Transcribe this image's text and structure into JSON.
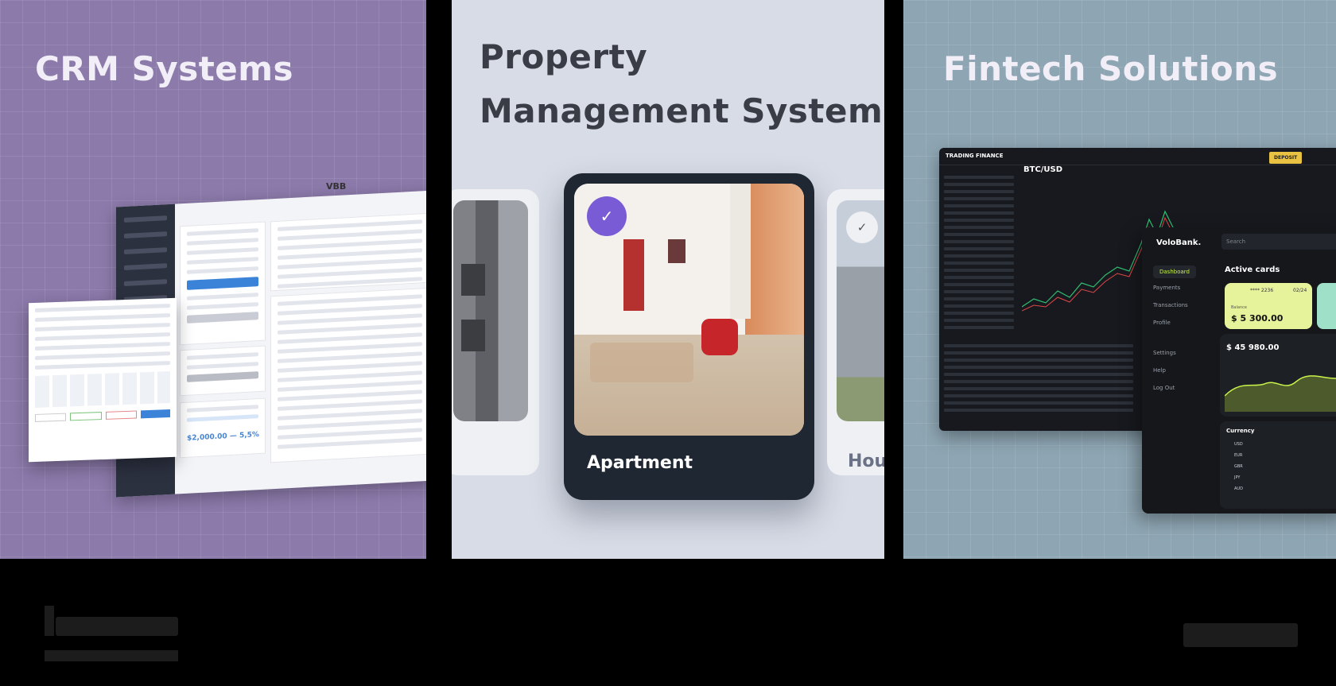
{
  "panels": [
    {
      "title": "CRM Systems"
    },
    {
      "title_line1": "Property",
      "title_line2": "Management System"
    },
    {
      "title": "Fintech Solutions"
    }
  ],
  "crm": {
    "brand": "VBB",
    "balance_value": "$2,000.00",
    "balance_change": "5,5%"
  },
  "property": {
    "card_label": "Apartment",
    "side_label": "Hous",
    "accent_color": "#7a5bd6"
  },
  "fintech": {
    "trading_brand": "TRADING FINANCE",
    "pair": "BTC/USD",
    "deposit_label": "DEPOSIT",
    "bank_brand": "VoloBank.",
    "search_placeholder": "Search",
    "nav": [
      "Dashboard",
      "Payments",
      "Transactions",
      "Profile",
      "Settings",
      "Help",
      "Log Out"
    ],
    "active_cards_title": "Active cards",
    "card_number": "**** 2236",
    "card_expiry": "02/24",
    "card_balance_label": "Balance",
    "card_balance": "$ 5 300.00",
    "total_balance": "$ 45 980.00",
    "currency_title": "Currency",
    "currencies": [
      "USD",
      "EUR",
      "GBR",
      "JPY",
      "AUD"
    ]
  }
}
